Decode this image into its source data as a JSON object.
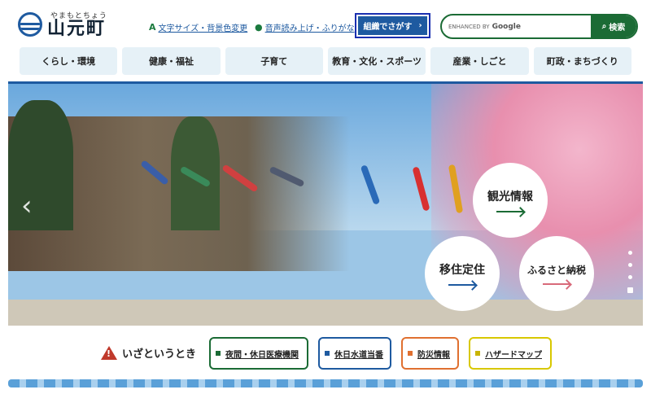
{
  "header": {
    "logo_kana": "やまもとちょう",
    "logo_name": "山元町",
    "util_text_size": "文字サイズ・背景色変更",
    "util_voice": "音声読み上げ・ふりがな",
    "org_search": "組織でさがす",
    "search_placeholder": "ENHANCED BY",
    "search_brand": "Google",
    "search_button": "検索"
  },
  "nav": [
    {
      "label": "くらし・環境"
    },
    {
      "label": "健康・福祉"
    },
    {
      "label": "子育て"
    },
    {
      "label": "教育・文化・スポーツ"
    },
    {
      "label": "産業・しごと"
    },
    {
      "label": "町政・まちづくり"
    }
  ],
  "hero": {
    "circle_tourism": "観光情報",
    "circle_migration": "移住定住",
    "circle_furusato": "ふるさと納税"
  },
  "emergency": {
    "title": "いざというとき",
    "links": [
      {
        "label": "夜間・休日医療機関",
        "color": "#1b6b35"
      },
      {
        "label": "休日水道当番",
        "color": "#1e5aa0"
      },
      {
        "label": "防災情報",
        "color": "#e07030"
      },
      {
        "label": "ハザードマップ",
        "color": "#c8b400"
      }
    ]
  },
  "colors": {
    "accent": "#1e5aa0",
    "green": "#1b6b35"
  }
}
